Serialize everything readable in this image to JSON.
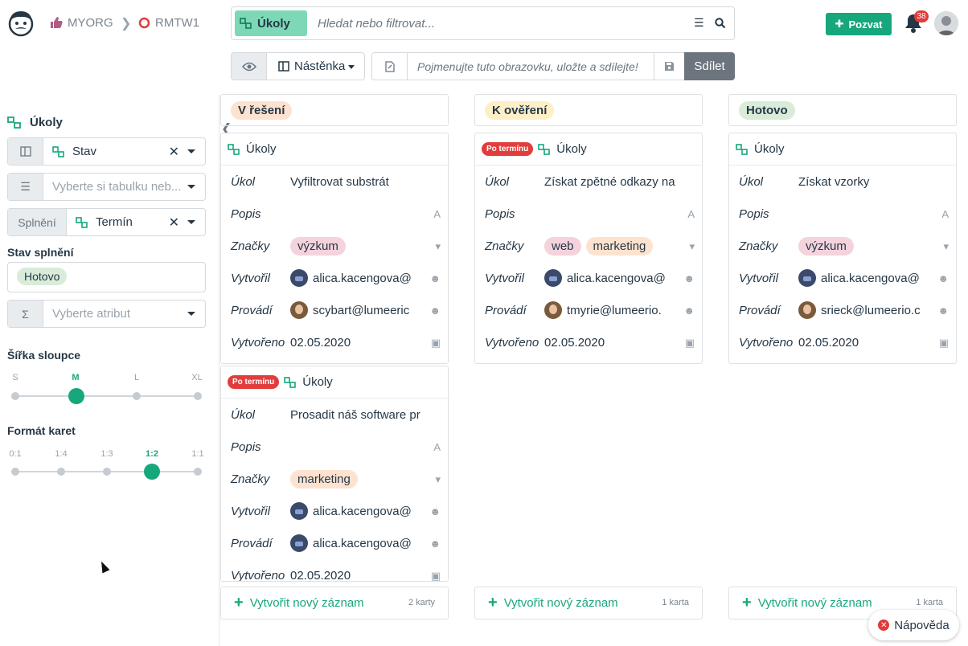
{
  "brand": {
    "accent": "#17a77d",
    "overdue_color": "#e23d3d"
  },
  "header": {
    "breadcrumb": [
      {
        "label": "MYORG",
        "icon": "thumbs-up-icon"
      },
      {
        "label": "RMTW1",
        "icon": "ring-icon"
      }
    ],
    "search": {
      "chip": "Úkoly",
      "placeholder": "Hledat nebo filtrovat..."
    },
    "invite_label": "Pozvat",
    "notifications": "38"
  },
  "toolbar": {
    "view_label": "Nástěnka",
    "name_placeholder": "Pojmenujte tuto obrazovku, uložte a sdílejte!",
    "share_label": "Sdílet"
  },
  "sidebar": {
    "collection": "Úkoly",
    "group_by": "Stav",
    "table_placeholder": "Vyberte si tabulku neb...",
    "done_label": "Splnění",
    "done_attr": "Termín",
    "done_state_label": "Stav splnění",
    "done_state_value": "Hotovo",
    "aggregate_placeholder": "Vyberte atribut",
    "width_label": "Šířka sloupce",
    "width_ticks": [
      "S",
      "M",
      "L",
      "XL"
    ],
    "width_selected": "M",
    "format_label": "Formát karet",
    "format_ticks": [
      "0:1",
      "1:4",
      "1:3",
      "1:2",
      "1:1"
    ],
    "format_selected": "1:2"
  },
  "board": {
    "field_labels": {
      "task": "Úkol",
      "desc": "Popis",
      "tags": "Značky",
      "created_by": "Vytvořil",
      "assignee": "Provádí",
      "created": "Vytvořeno"
    },
    "overdue_label": "Po termínu",
    "card_collection": "Úkoly",
    "new_record": "Vytvořit nový záznam",
    "columns": [
      {
        "title": "V řešení",
        "chip_bg": "#fde3cf",
        "count": "2 karty",
        "cards": [
          {
            "overdue": false,
            "task": "Vyfiltrovat substrát",
            "tags": [
              {
                "t": "výzkum",
                "bg": "#f5d3dc"
              }
            ],
            "created_by": "alica.kacengova@",
            "assignee": "scybart@lumeeric",
            "created": "02.05.2020"
          },
          {
            "overdue": true,
            "task": "Prosadit náš software pr",
            "tags": [
              {
                "t": "marketing",
                "bg": "#fde3cf"
              }
            ],
            "created_by": "alica.kacengova@",
            "assignee": "alica.kacengova@",
            "created": "02.05.2020"
          }
        ]
      },
      {
        "title": "K ověření",
        "chip_bg": "#fdf0c8",
        "count": "1 karta",
        "cards": [
          {
            "overdue": true,
            "task": "Získat zpětné odkazy na",
            "tags": [
              {
                "t": "web",
                "bg": "#f5d3dc"
              },
              {
                "t": "marketing",
                "bg": "#fde3cf"
              }
            ],
            "created_by": "alica.kacengova@",
            "assignee": "tmyrie@lumeerio.",
            "created": "02.05.2020"
          }
        ]
      },
      {
        "title": "Hotovo",
        "chip_bg": "#d9ecd9",
        "count": "1 karta",
        "cards": [
          {
            "overdue": false,
            "task": "Získat vzorky",
            "tags": [
              {
                "t": "výzkum",
                "bg": "#f5d3dc"
              }
            ],
            "created_by": "alica.kacengova@",
            "assignee": "srieck@lumeerio.c",
            "created": "02.05.2020"
          }
        ]
      }
    ]
  },
  "help_label": "Nápověda"
}
